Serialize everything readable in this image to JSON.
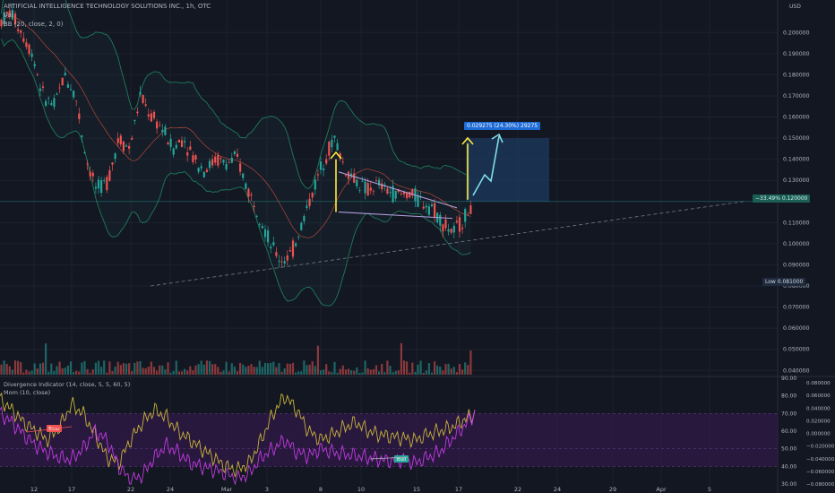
{
  "header": {
    "symbol_line": "ARTIFICIAL INTELLIGENCE TECHNOLOGY SOLUTIONS INC., 1h, OTC",
    "vol_label": "Vol",
    "bb_label": "BB (20, close, 2, 0)"
  },
  "colors": {
    "background": "#131722",
    "up": "#26a69a",
    "down": "#ef5350",
    "band": "#1f7a5a",
    "basis": "#b7473a",
    "triangle": "#b39ddb",
    "arrow_yellow": "#ffeb3b",
    "arrow_cyan": "#80deea",
    "projection_box": "#1e3a5f",
    "osc_primary": "#c8b33a",
    "osc_secondary": "#c13be0",
    "osc_band": "#3b1a55"
  },
  "chart_data": [
    {
      "type": "candlestick",
      "currency": "USD",
      "y_axis_ticks": [
        "0.200000",
        "0.190000",
        "0.180000",
        "0.170000",
        "0.160000",
        "0.150000",
        "0.140000",
        "0.130000",
        "0.110000",
        "0.100000",
        "0.090000",
        "0.080000",
        "0.070000",
        "0.060000",
        "0.050000",
        "0.040000"
      ],
      "ylim": [
        0.038,
        0.212
      ],
      "x_axis_ticks": [
        "12",
        "17",
        "22",
        "24",
        "Mar",
        "3",
        "8",
        "10",
        "15",
        "17",
        "22",
        "24",
        "29",
        "Apr",
        "5"
      ],
      "price_samples": [
        0.205,
        0.21,
        0.2,
        0.19,
        0.17,
        0.165,
        0.18,
        0.17,
        0.14,
        0.125,
        0.13,
        0.15,
        0.145,
        0.17,
        0.16,
        0.155,
        0.145,
        0.15,
        0.14,
        0.135,
        0.14,
        0.138,
        0.14,
        0.125,
        0.115,
        0.1,
        0.092,
        0.095,
        0.11,
        0.125,
        0.14,
        0.15,
        0.135,
        0.13,
        0.125,
        0.128,
        0.125,
        0.123,
        0.124,
        0.12,
        0.118,
        0.11,
        0.105,
        0.112,
        0.12
      ],
      "bollinger": {
        "period": 20,
        "source": "close",
        "stddev": 2,
        "offset": 0
      },
      "annotations": {
        "current_price_tag": {
          "text": "0.120000",
          "pct": "−33.49%"
        },
        "low_tag": {
          "label": "Low",
          "value": "0.081000"
        },
        "projection": {
          "text": "0.029275 (24.30%) 29275",
          "from": 0.12,
          "to": 0.15
        },
        "trendline_support": {
          "from": 0.08,
          "to": 0.12
        },
        "triangle_upper": {
          "from": 0.134,
          "to": 0.117
        },
        "triangle_lower": {
          "from": 0.115,
          "to": 0.112
        }
      }
    },
    {
      "type": "line",
      "indicator": "Divergence Indicator (14, close, 5, 5, 60, 5)",
      "second_indicator": "Mom (10, close)",
      "ylim": [
        30,
        90
      ],
      "y_axis_ticks_left": [
        "90.00",
        "80.00",
        "70.00",
        "60.00",
        "50.00",
        "40.00",
        "30.00"
      ],
      "y_axis_ticks_right": [
        "0.080000",
        "0.060000",
        "0.040000",
        "0.020000",
        "0.000000",
        "−0.020000",
        "−0.040000",
        "−0.060000",
        "−0.080000"
      ],
      "band": [
        40,
        70
      ],
      "series": [
        {
          "values": [
            78,
            72,
            65,
            60,
            55,
            62,
            75,
            70,
            58,
            45,
            42,
            55,
            65,
            72,
            68,
            60,
            55,
            50,
            45,
            40,
            38,
            42,
            55,
            70,
            80,
            72,
            60,
            55,
            58,
            62,
            65,
            60,
            58,
            57,
            56,
            55,
            58,
            60,
            62,
            66,
            70
          ]
        },
        {
          "values": [
            70,
            65,
            58,
            52,
            48,
            45,
            44,
            50,
            60,
            55,
            40,
            32,
            35,
            45,
            52,
            48,
            42,
            40,
            38,
            36,
            33,
            36,
            45,
            50,
            55,
            48,
            46,
            50,
            48,
            47,
            46,
            45,
            44,
            43,
            44,
            42,
            45,
            48,
            55,
            62,
            70
          ]
        }
      ],
      "labels": {
        "bear": "Bear",
        "bull": "Bull"
      }
    }
  ]
}
